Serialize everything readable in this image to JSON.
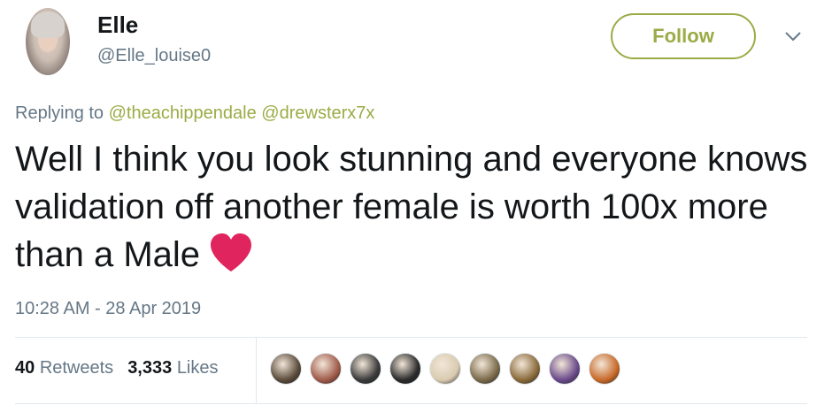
{
  "user": {
    "display_name": "Elle",
    "handle": "@Elle_louise0"
  },
  "actions": {
    "follow_label": "Follow"
  },
  "reply": {
    "prefix": "Replying to",
    "mentions": [
      "@theachippendale",
      "@drewsterx7x"
    ]
  },
  "tweet": {
    "text": "Well I think you look stunning and everyone knows validation off another female is worth 100x more than a Male",
    "emoji": "heart-icon"
  },
  "meta": {
    "timestamp": "10:28 AM - 28 Apr 2019"
  },
  "stats": {
    "retweets_count": "40",
    "retweets_label": "Retweets",
    "likes_count": "3,333",
    "likes_label": "Likes"
  },
  "likers": [
    {
      "name": "liker-avatar-1",
      "color": "#5a4a3a"
    },
    {
      "name": "liker-avatar-2",
      "color": "#a05a4a"
    },
    {
      "name": "liker-avatar-3",
      "color": "#3a3a3a"
    },
    {
      "name": "liker-avatar-4",
      "color": "#2a2a2a"
    },
    {
      "name": "liker-avatar-5",
      "color": "#d9cbb0"
    },
    {
      "name": "liker-avatar-6",
      "color": "#7a6a4a"
    },
    {
      "name": "liker-avatar-7",
      "color": "#8a6a3a"
    },
    {
      "name": "liker-avatar-8",
      "color": "#6a4a8a"
    },
    {
      "name": "liker-avatar-9",
      "color": "#c86a2a"
    }
  ],
  "colors": {
    "accent": "#9bab45",
    "secondary_text": "#657786",
    "heart": "#e0245e"
  }
}
